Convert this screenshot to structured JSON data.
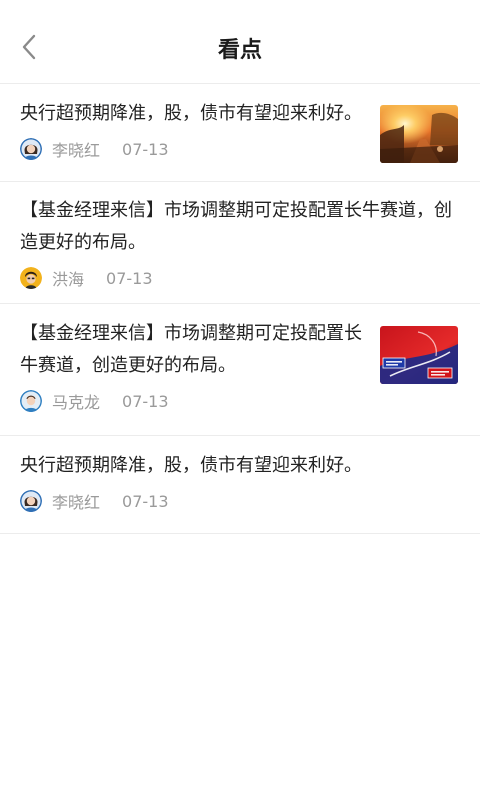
{
  "header": {
    "title": "看点",
    "back_icon": "chevron-left-icon"
  },
  "items": [
    {
      "title": "央行超预期降准，股，债市有望迎来利好。",
      "author": "李晓红",
      "date": "07-13",
      "avatar": "female-avatar-blue",
      "thumbnail": "sunset-path-photo"
    },
    {
      "title": "【基金经理来信】市场调整期可定投配置长牛赛道，创造更好的布局。",
      "author": "洪海",
      "date": "07-13",
      "avatar": "male-avatar-yellow"
    },
    {
      "title": "【基金经理来信】市场调整期可定投配置长牛赛道，创造更好的布局。",
      "author": "马克龙",
      "date": "07-13",
      "avatar": "male-avatar-blue",
      "thumbnail": "red-promo-banner"
    },
    {
      "title": "央行超预期降准，股，债市有望迎来利好。",
      "author": "李晓红",
      "date": "07-13",
      "avatar": "female-avatar-blue"
    }
  ],
  "colors": {
    "divider": "#ececec",
    "meta_text": "#9a9a9a",
    "title_text": "#222222"
  }
}
